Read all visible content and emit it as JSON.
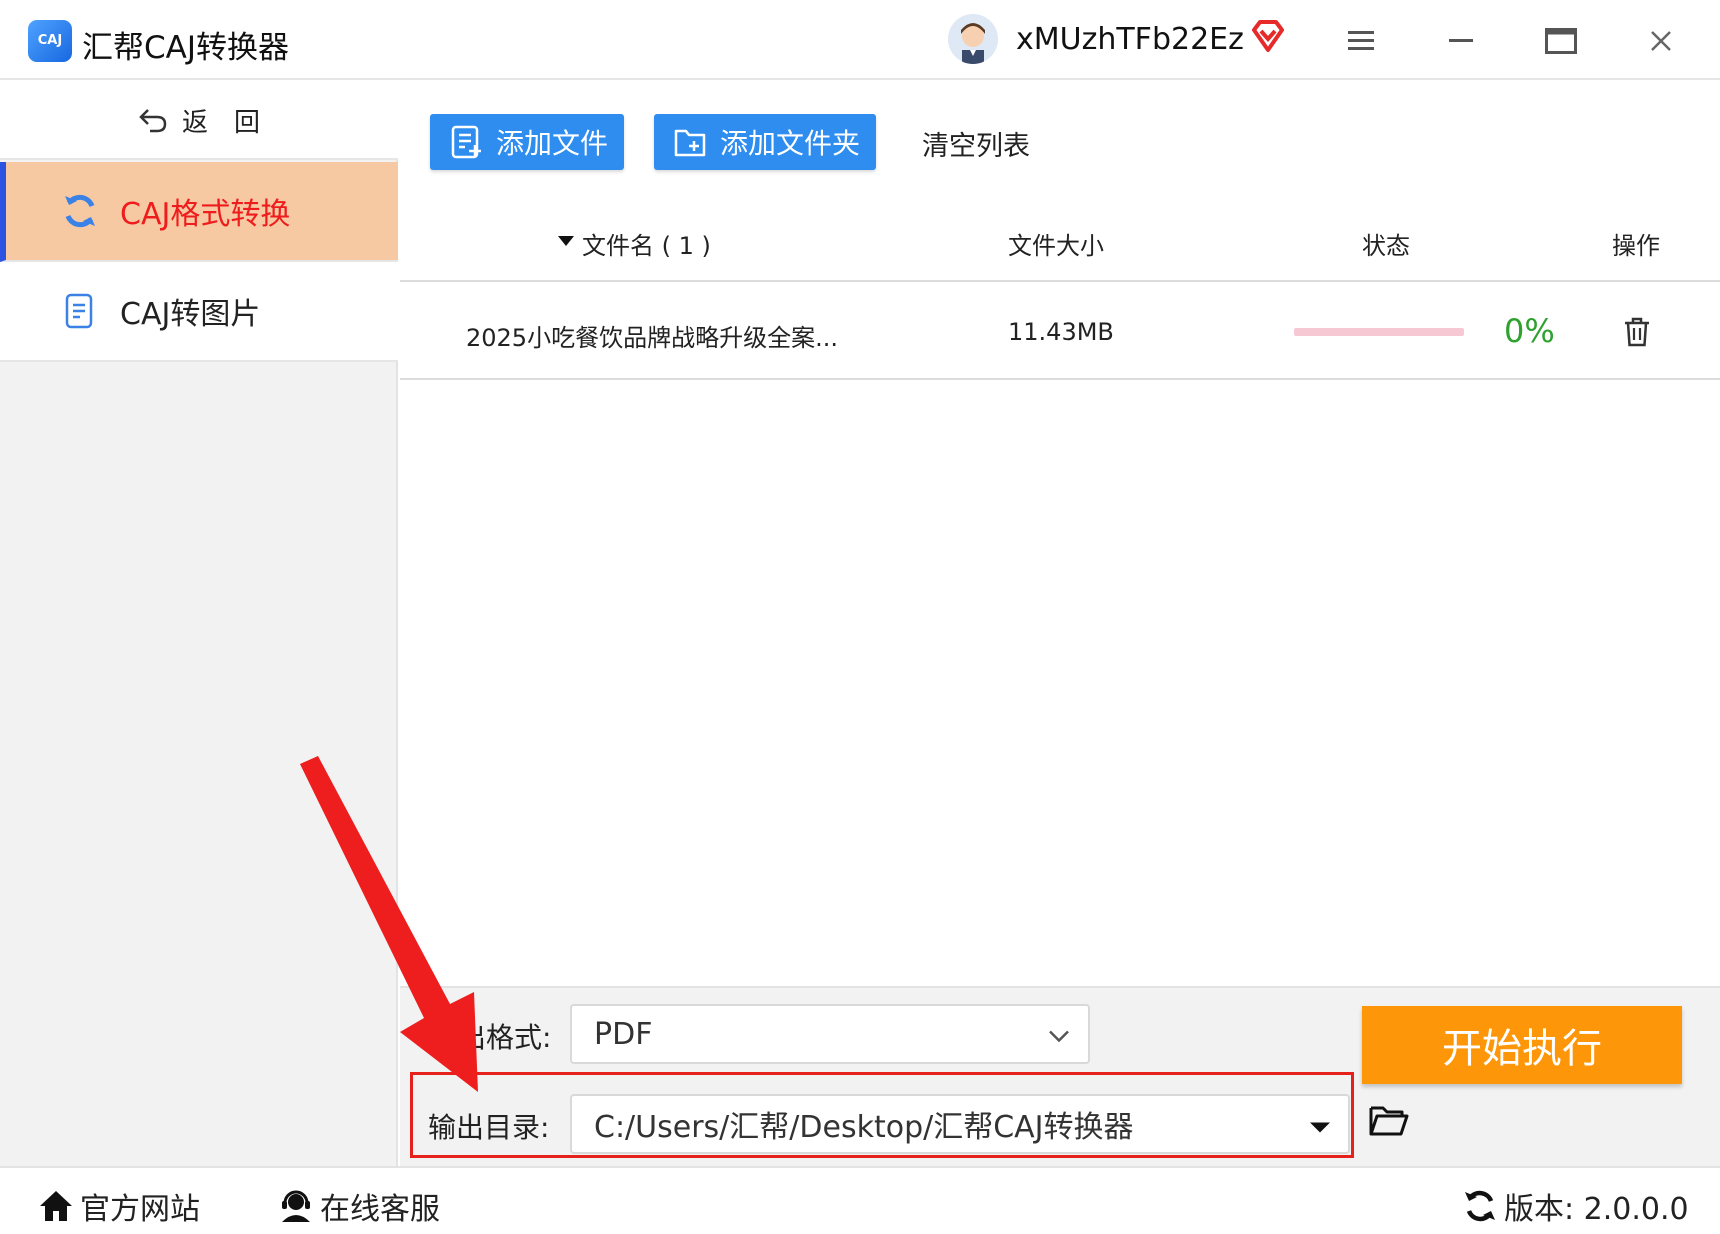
{
  "window": {
    "app_title": "汇帮CAJ转换器",
    "logo_text": "CAJ",
    "username": "xMUzhTFb22Ez"
  },
  "sidebar": {
    "back_label": "返　回",
    "items": [
      {
        "label": "CAJ格式转换",
        "icon": "refresh-icon",
        "active": true
      },
      {
        "label": "CAJ转图片",
        "icon": "document-icon",
        "active": false
      }
    ]
  },
  "toolbar": {
    "add_file_label": "添加文件",
    "add_folder_label": "添加文件夹",
    "clear_list_label": "清空列表"
  },
  "table": {
    "columns": {
      "filename": "文件名 ( 1 )",
      "size": "文件大小",
      "status": "状态",
      "action": "操作"
    },
    "rows": [
      {
        "filename": "2025小吃餐饮品牌战略升级全案...",
        "size": "11.43MB",
        "progress": 0,
        "progress_text": "0%"
      }
    ]
  },
  "settings": {
    "format_label": "出格式:",
    "format_value": "PDF",
    "output_dir_label": "输出目录:",
    "output_dir_value": "C:/Users/汇帮/Desktop/汇帮CAJ转换器",
    "start_label": "开始执行"
  },
  "statusbar": {
    "website_label": "官方网站",
    "support_label": "在线客服",
    "version_label": "版本: 2.0.0.0"
  },
  "colors": {
    "accent_blue": "#2f8df0",
    "active_nav_bg": "#f7c9a3",
    "active_nav_text": "#ee1c1c",
    "start_orange": "#fd9709",
    "annotation_red": "#e6201b",
    "progress_green": "#2fa12f"
  }
}
